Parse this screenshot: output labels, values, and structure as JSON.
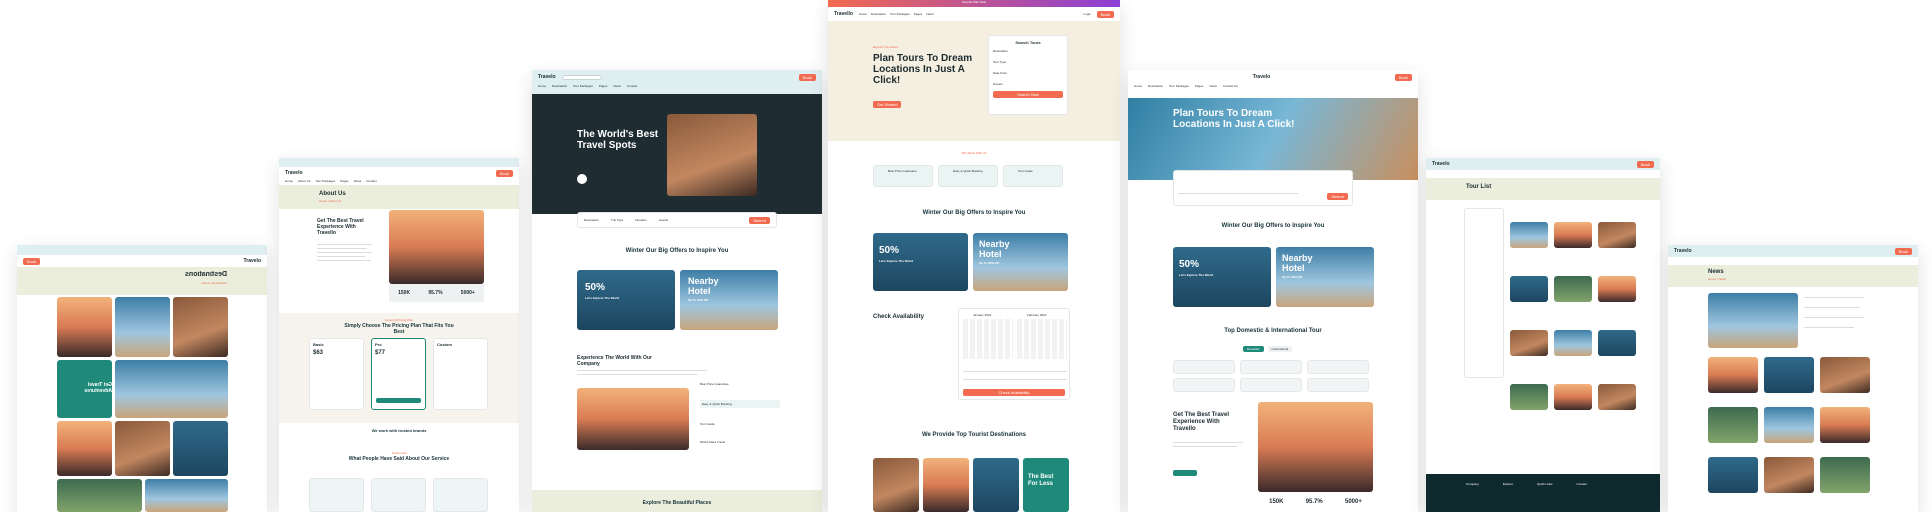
{
  "shot_a": {
    "logo": "Travelo",
    "heading": "Destinations",
    "heading_mirror": "Destinations",
    "breadcrumb": "Home / Destination"
  },
  "shot_b": {
    "logo": "Travelo",
    "nav": [
      "Home",
      "About Us",
      "Tour Packages",
      "Pages",
      "News",
      "Contact"
    ],
    "page_title": "About Us",
    "breadcrumb": "Home / About Us",
    "intro_heading": "Get The Best Travel Experience With Travello",
    "stats": [
      "150K",
      "95.7%",
      "5000+"
    ],
    "pricing_kicker": "Amazing Pricing Plan",
    "pricing_heading": "Simply Choose The Pricing Plan That Fits You Best",
    "plans": [
      {
        "name": "Basic",
        "price": "$63"
      },
      {
        "name": "Pro",
        "price": "$77"
      },
      {
        "name": "Custom",
        "price": ""
      }
    ],
    "clients_heading": "We work with trusted brands",
    "testimonial_kicker": "Testimonial",
    "testimonial_heading": "What People Have Said About Our Service"
  },
  "shot_c": {
    "logo": "Travelo",
    "nav": [
      "Home",
      "Destination",
      "Tour Packages",
      "Pages",
      "News",
      "Contact"
    ],
    "hero_title": "The World's Best Travel Spots",
    "search_fields": [
      "Destination",
      "Trip Type",
      "Duration",
      "Guests"
    ],
    "search_button": "Search",
    "offers_heading": "Winter Our Big Offers to Inspire You",
    "offer_1": {
      "big": "50%",
      "sub": "Let's Explore The World"
    },
    "offer_2": {
      "big": "Nearby Hotel",
      "sub": "Up To 30% Off"
    },
    "experience_heading": "Experience The World With Our Company",
    "features": [
      "Best Price Guarantee",
      "Easy & Quick Booking",
      "Tour Guide",
      "World Class Travel"
    ],
    "bottom_heading": "Explore The Beautiful Places"
  },
  "shot_d": {
    "banner": "Special Offer Sale",
    "logo": "Travello",
    "nav": [
      "Home",
      "Destination",
      "Tour Packages",
      "Pages",
      "News"
    ],
    "login": "Login",
    "kicker": "Explore The World",
    "hero_title": "Plan Tours To Dream Locations In Just A Click!",
    "hero_button": "Get Started",
    "search_title": "Search Tours",
    "search_fields": [
      "Destination",
      "Tour Type",
      "Date From",
      "Guests"
    ],
    "search_button": "Search Now",
    "services_kicker": "Why Book With Us",
    "services": [
      "Best Price Guarantee",
      "Easy & Quick Booking",
      "Tour Guide"
    ],
    "offers_heading": "Winter Our Big Offers to Inspire You",
    "offer_1": {
      "big": "50%",
      "sub": "Let's Explore The World"
    },
    "offer_2": {
      "big": "Nearby Hotel",
      "sub": "Up To 30% Off"
    },
    "availability_heading": "Check Availability",
    "calendar_months": [
      "January 2024",
      "February 2024"
    ],
    "check_button": "Check Availability",
    "destinations_heading": "We Provide Top Tourist Destinations",
    "best_card": "The Best For Less"
  },
  "shot_e": {
    "logo": "Travelo",
    "nav": [
      "Home",
      "Destination",
      "Tour Packages",
      "Pages",
      "News",
      "Contact Us"
    ],
    "hero_title": "Plan Tours To Dream Locations In Just A Click!",
    "search_button": "Search",
    "offers_heading": "Winter Our Big Offers to Inspire You",
    "offer_1": {
      "big": "50%",
      "sub": "Let's Explore The World"
    },
    "offer_2": {
      "big": "Nearby Hotel",
      "sub": "Up To 30% Off"
    },
    "tour_heading": "Top Domestic & International Tour",
    "tour_tabs": [
      "Domestic",
      "International"
    ],
    "about_heading": "Get The Best Travel Experience With Travello",
    "stats": [
      "150K",
      "95.7%",
      "5000+"
    ]
  },
  "shot_f": {
    "logo": "Travelo",
    "page_title": "Tour List",
    "footer_cols": [
      "Company",
      "Explore",
      "Quick Links",
      "Contact"
    ]
  },
  "shot_g": {
    "logo": "Travelo",
    "page_title": "News",
    "breadcrumb": "Home / News"
  }
}
